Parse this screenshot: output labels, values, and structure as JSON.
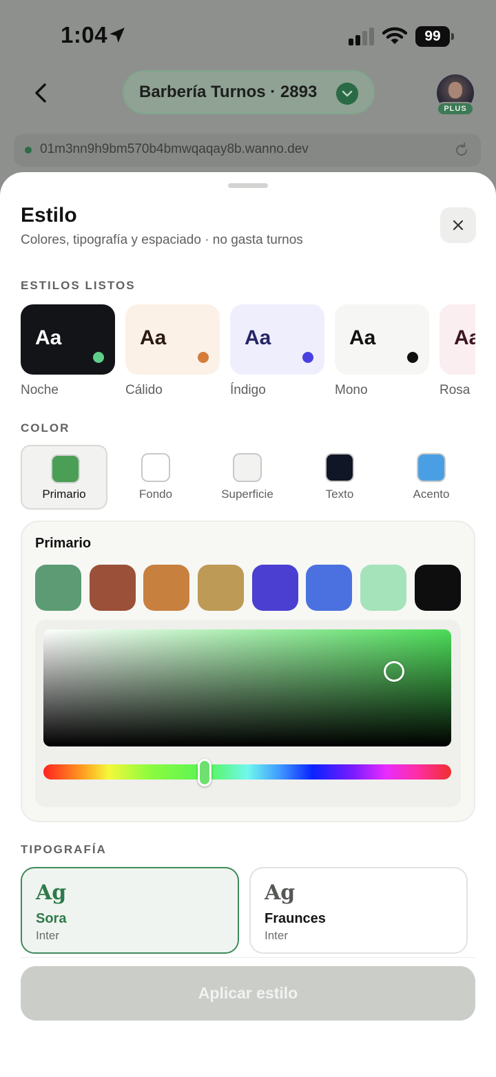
{
  "status_bar": {
    "time": "1:04",
    "battery": "99"
  },
  "header": {
    "project_name": "Barbería Turnos · 2893",
    "plan_badge": "PLUS"
  },
  "url_bar": {
    "url": "01m3nn9h9bm570b4bmwqaqay8b.wanno.dev"
  },
  "sheet": {
    "title": "Estilo",
    "subtitle": "Colores, tipografía y espaciado · no gasta turnos",
    "presets_label": "ESTILOS LISTOS",
    "presets": [
      {
        "label": "Noche",
        "sample": "Aa",
        "bg": "#121417",
        "text_color": "#ffffff",
        "dot": "#5fce8a"
      },
      {
        "label": "Cálido",
        "sample": "Aa",
        "bg": "#fcf1e6",
        "text_color": "#2a1a10",
        "dot": "#d47d3b"
      },
      {
        "label": "Índigo",
        "sample": "Aa",
        "bg": "#efeefc",
        "text_color": "#252566",
        "dot": "#4a40e0"
      },
      {
        "label": "Mono",
        "sample": "Aa",
        "bg": "#f6f6f4",
        "text_color": "#111111",
        "dot": "#111111"
      },
      {
        "label": "Rosa",
        "sample": "Aa",
        "bg": "#fbeef0",
        "text_color": "#3a1520",
        "dot": "#d04a70"
      }
    ],
    "color_label": "COLOR",
    "color_roles": [
      {
        "label": "Primario",
        "swatch": "#4a9e55",
        "selected": true
      },
      {
        "label": "Fondo",
        "swatch": "#ffffff",
        "selected": false
      },
      {
        "label": "Superficie",
        "swatch": "#f2f2f0",
        "selected": false
      },
      {
        "label": "Texto",
        "swatch": "#111626",
        "selected": false
      },
      {
        "label": "Acento",
        "swatch": "#4a9fe4",
        "selected": false
      }
    ],
    "picker": {
      "title": "Primario",
      "palette": [
        "#5c9b73",
        "#9b5039",
        "#c8803f",
        "#bd9a55",
        "#4a3fd0",
        "#4a71df",
        "#a5e3bb",
        "#0e0e0e"
      ],
      "saturation": 0.86,
      "value": 0.64,
      "hue": 0.395
    },
    "typography_label": "TIPOGRAFÍA",
    "fonts": [
      {
        "sample": "Ag",
        "name": "Sora",
        "sub": "Inter",
        "selected": true
      },
      {
        "sample": "Ag",
        "name": "Fraunces",
        "sub": "Inter",
        "selected": false
      }
    ],
    "apply_label": "Aplicar estilo"
  }
}
